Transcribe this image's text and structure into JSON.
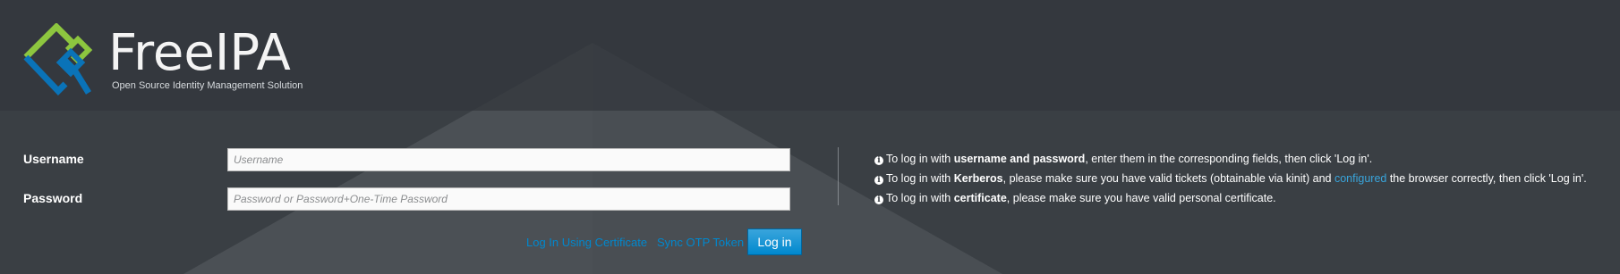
{
  "brand": {
    "name": "FreeIPA",
    "tagline": "Open Source Identity Management Solution"
  },
  "colors": {
    "background": "#3a3f44",
    "header": "#32363b",
    "accent_blue": "#0088ce",
    "logo_green": "#8dc63f",
    "logo_blue": "#0a73b8"
  },
  "form": {
    "username_label": "Username",
    "username_placeholder": "Username",
    "username_value": "",
    "password_label": "Password",
    "password_placeholder": "Password or Password+One-Time Password",
    "password_value": "",
    "cert_link": "Log In Using Certificate",
    "otp_link": "Sync OTP Token",
    "login_button": "Log in"
  },
  "help": {
    "icon": "info-circle-icon",
    "line1": {
      "prefix": "To log in with ",
      "bold": "username and password",
      "suffix": ", enter them in the corresponding fields, then click 'Log in'."
    },
    "line2": {
      "prefix": "To log in with ",
      "bold": "Kerberos",
      "middle": ", please make sure you have valid tickets (obtainable via kinit) and ",
      "link": "configured",
      "suffix": " the browser correctly, then click 'Log in'."
    },
    "line3": {
      "prefix": "To log in with ",
      "bold": "certificate",
      "suffix": ", please make sure you have valid personal certificate."
    }
  }
}
